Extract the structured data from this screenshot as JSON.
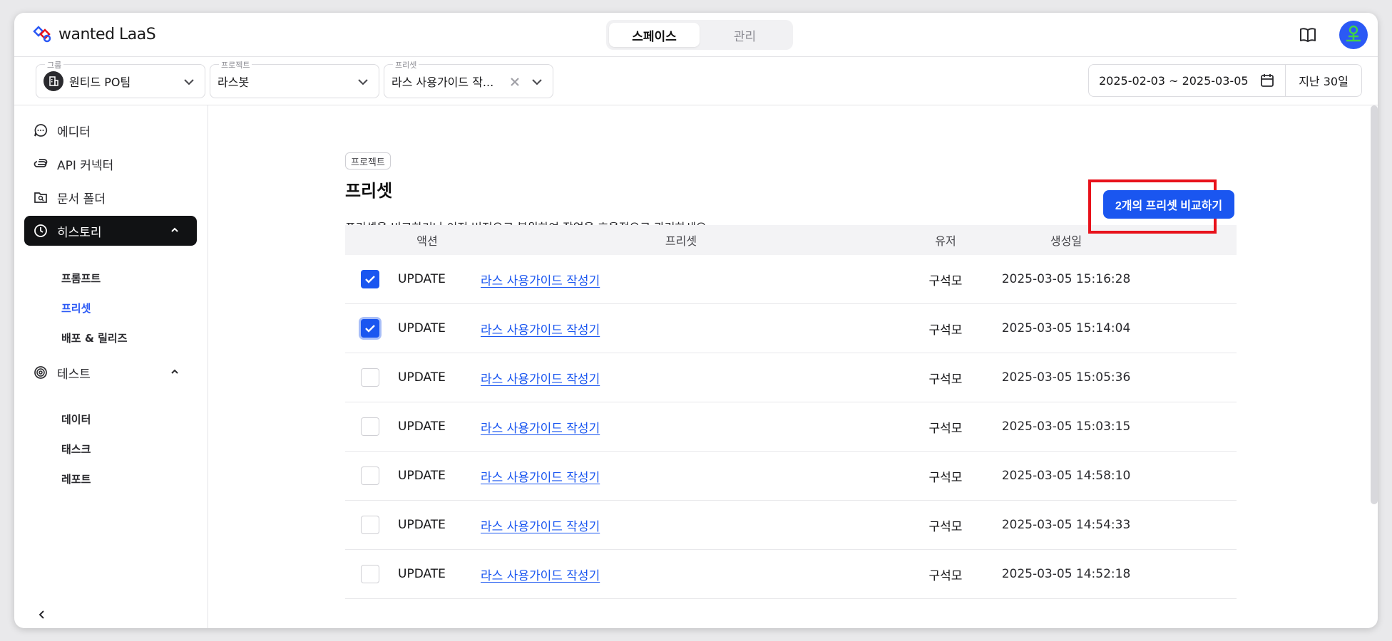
{
  "app": {
    "logo_text": "wanted LaaS"
  },
  "top_tabs": [
    {
      "label": "스페이스",
      "active": true
    },
    {
      "label": "관리",
      "active": false
    }
  ],
  "filters": {
    "group": {
      "label": "그룹",
      "value": "원티드 PO팀"
    },
    "project": {
      "label": "프로젝트",
      "value": "라스봇"
    },
    "preset": {
      "label": "프리셋",
      "value": "라스 사용가이드 작..."
    },
    "date_range": "2025-02-03 ~ 2025-03-05",
    "period": "지난 30일"
  },
  "sidebar": {
    "items": [
      {
        "label": "에디터",
        "icon": "chat-icon"
      },
      {
        "label": "API 커넥터",
        "icon": "link-icon"
      },
      {
        "label": "문서 폴더",
        "icon": "folder-search-icon"
      },
      {
        "label": "히스토리",
        "icon": "clock-icon",
        "active": true
      },
      {
        "label": "테스트",
        "icon": "target-icon"
      }
    ],
    "history_sub": [
      {
        "label": "프롬프트"
      },
      {
        "label": "프리셋",
        "active": true
      },
      {
        "label": "배포 & 릴리즈"
      }
    ],
    "test_sub": [
      {
        "label": "데이터"
      },
      {
        "label": "태스크"
      },
      {
        "label": "레포트"
      }
    ]
  },
  "main": {
    "tag": "프로젝트",
    "title": "프리셋",
    "description": "프리셋을 비교하거나 이전 버전으로 복원하여 작업을 효율적으로 관리하세요.",
    "compare_button": "2개의 프리셋 비교하기",
    "accent_color": "#1a56f0",
    "highlight_color": "#e8121b"
  },
  "table": {
    "headers": {
      "action": "액션",
      "preset": "프리셋",
      "user": "유저",
      "created": "생성일"
    },
    "rows": [
      {
        "checked": true,
        "action": "UPDATE",
        "preset": "라스 사용가이드 작성기",
        "user": "구석모",
        "created": "2025-03-05 15:16:28"
      },
      {
        "checked": true,
        "action": "UPDATE",
        "preset": "라스 사용가이드 작성기",
        "user": "구석모",
        "created": "2025-03-05 15:14:04"
      },
      {
        "checked": false,
        "action": "UPDATE",
        "preset": "라스 사용가이드 작성기",
        "user": "구석모",
        "created": "2025-03-05 15:05:36"
      },
      {
        "checked": false,
        "action": "UPDATE",
        "preset": "라스 사용가이드 작성기",
        "user": "구석모",
        "created": "2025-03-05 15:03:15"
      },
      {
        "checked": false,
        "action": "UPDATE",
        "preset": "라스 사용가이드 작성기",
        "user": "구석모",
        "created": "2025-03-05 14:58:10"
      },
      {
        "checked": false,
        "action": "UPDATE",
        "preset": "라스 사용가이드 작성기",
        "user": "구석모",
        "created": "2025-03-05 14:54:33"
      },
      {
        "checked": false,
        "action": "UPDATE",
        "preset": "라스 사용가이드 작성기",
        "user": "구석모",
        "created": "2025-03-05 14:52:18"
      }
    ]
  }
}
